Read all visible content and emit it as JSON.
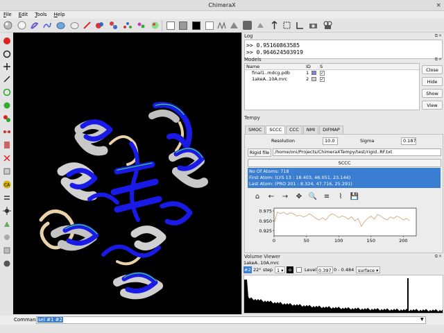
{
  "window": {
    "title": "ChimeraX",
    "close_glyph": "×"
  },
  "menu": {
    "items": [
      "File",
      "Edit",
      "Tools",
      "Help"
    ]
  },
  "toolbar": {
    "icons": [
      "sphere-icon",
      "ball-icon",
      "stick-icon",
      "wire-icon",
      "surface-blob-icon",
      "mesh-icon",
      "cartoon-icon",
      "ribbon-atoms-icon",
      "atoms-icon",
      "ball-stick-icon",
      "hetero-icon",
      "molecule-color-icon",
      "rainbow-icon",
      "white-bg-icon",
      "gray-bg-icon",
      "black-bg-icon",
      "lighting-simple-icon",
      "lighting-full-icon",
      "lighting-soft-icon",
      "camera-view-icon",
      "move-icon",
      "rotate-icon",
      "zoom-icon",
      "crop-icon",
      "snapshot-icon",
      "movie-icon"
    ]
  },
  "left_tools": {
    "icons": [
      "select-icon",
      "rotate-mouse-icon",
      "translate-icon",
      "zoom-mouse-icon",
      "rotate-z-icon",
      "color-icon",
      "pick-atom-icon",
      "distance-icon",
      "label-icon",
      "contour-icon",
      "clip-icon",
      "ca-label-icon",
      "swap-icon",
      "move-atoms-icon",
      "map-values-icon",
      "bond-icon",
      "fit-icon",
      "tug-icon"
    ]
  },
  "log": {
    "title": "Log",
    "lines": [
      ">> 0.95160863585",
      ">> 0.964624503919"
    ]
  },
  "models": {
    "title": "Models",
    "columns": [
      "Name",
      "ID",
      "",
      "S"
    ],
    "rows": [
      {
        "name": "final1..mdcg.pdb",
        "id": "1",
        "color": "#8080e0",
        "shown": "✓"
      },
      {
        "name": "1akeA..10A.mrc",
        "id": "2",
        "color": "#cfcfcf",
        "shown": "✓"
      }
    ],
    "buttons": [
      "Close",
      "Hide",
      "Show",
      "View"
    ]
  },
  "tempy": {
    "title": "Tempy",
    "tabs": [
      "SMOC",
      "SCCC",
      "CCC",
      "NMI",
      "DIFMAP"
    ],
    "active_tab": "SCCC",
    "resolution_label": "Resolution",
    "resolution_value": "10.0",
    "sigma_label": "Sigma",
    "sigma_value": "0.187",
    "rigid_file_button": "Rigid file",
    "rigid_file_path": "/home/oni/Projects/ChimeraXTempy/test/rigid..RF.txt",
    "run_button": "SCCC",
    "info": [
      "No Of Atoms: 718",
      "First Atom: (LYS 13 : 18.403, 46.051, 23.144)",
      "Last Atom: (PRO 201 : 8.324, 47.716, 25.291)"
    ],
    "plot_tools": [
      "⌂",
      "←",
      "→",
      "✥",
      "🔍",
      "≡",
      "⌇",
      "💾"
    ]
  },
  "chart_data": {
    "type": "line",
    "x": [
      1,
      5,
      10,
      15,
      20,
      25,
      30,
      35,
      40,
      45,
      50,
      55,
      60,
      65,
      70,
      75,
      80,
      85,
      90,
      95,
      100,
      105,
      110,
      115,
      120,
      125,
      130,
      135,
      140,
      145,
      150,
      155,
      160,
      165,
      170,
      175,
      180,
      185,
      190,
      195,
      200,
      205,
      210
    ],
    "series": [
      {
        "values": [
          0.948,
          0.972,
          0.968,
          0.972,
          0.966,
          0.97,
          0.968,
          0.962,
          0.964,
          0.96,
          0.962,
          0.968,
          0.962,
          0.956,
          0.952,
          0.958,
          0.952,
          0.962,
          0.968,
          0.964,
          0.958,
          0.962,
          0.96,
          0.954,
          0.96,
          0.95,
          0.956,
          0.936,
          0.948,
          0.956,
          0.962,
          0.954,
          0.966,
          0.962,
          0.956,
          0.952,
          0.96,
          0.956,
          0.962,
          0.958,
          0.952,
          0.956,
          0.95
        ]
      }
    ],
    "yticks": [
      "0.975",
      "0.950",
      "0.925"
    ],
    "xticks": [
      "0",
      "50",
      "100",
      "150",
      "200"
    ],
    "xlim": [
      0,
      220
    ],
    "ylim": [
      0.912,
      0.982
    ],
    "color": "#d0a070"
  },
  "volume_viewer": {
    "title": "Volume Viewer",
    "map_name": "1akeA..10A.mrc",
    "model_id": "#2",
    "size": "22³",
    "step_label": "step",
    "step_value": "1",
    "level_label": "Level",
    "level_value": "0.397",
    "range": "0 - 0.484",
    "style": "surface"
  },
  "command": {
    "label": "Command:",
    "value": "sel #1 #2"
  },
  "colors": {
    "viewport_bg": "#000000",
    "selection_blue": "#3a7ed1",
    "ribbon_blue": "#1a1ae6",
    "ribbon_gray": "#c8c8c8",
    "ribbon_tan": "#e8d2a8"
  }
}
